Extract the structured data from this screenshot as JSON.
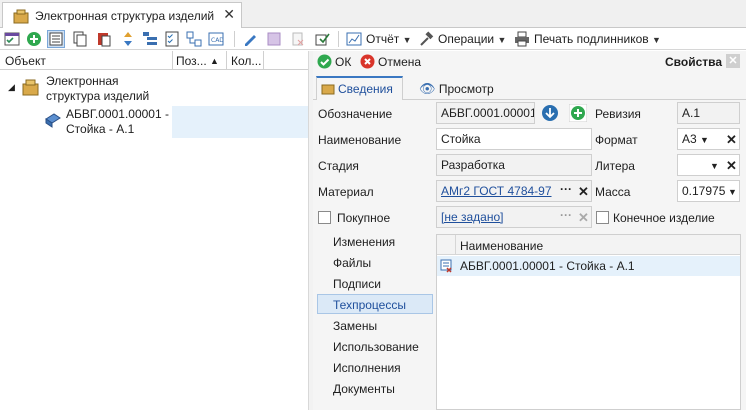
{
  "tab": {
    "title": "Электронная структура изделий",
    "close": "✕"
  },
  "toolbar": {
    "report_label": "Отчёт",
    "operations_label": "Операции",
    "print_label": "Печать подлинников"
  },
  "tree": {
    "columns": [
      "Объект",
      "Поз...",
      "Кол..."
    ],
    "root_label_line1": "Электронная",
    "root_label_line2": "структура изделий",
    "child_label_line1": "АБВГ.0001.00001 -",
    "child_label_line2": "Стойка - А.1"
  },
  "props": {
    "ok_label": "ОК",
    "cancel_label": "Отмена",
    "title": "Свойства",
    "tabs": [
      "Сведения",
      "Просмотр"
    ],
    "fields": {
      "designation_label": "Обозначение",
      "designation_value": "АБВГ.0001.00001",
      "revision_label": "Ревизия",
      "revision_value": "А.1",
      "name_label": "Наименование",
      "name_value": "Стойка",
      "format_label": "Формат",
      "format_value": "А3",
      "stage_label": "Стадия",
      "stage_value": "Разработка",
      "litera_label": "Литера",
      "litera_value": "",
      "material_label": "Материал",
      "material_value": "АМг2 ГОСТ 4784-97",
      "mass_label": "Масса",
      "mass_value": "0.17975",
      "purchased_label": "Покупное",
      "purchased_value": "[не задано]",
      "final_label": "Конечное изделие"
    },
    "nav": [
      "Изменения",
      "Файлы",
      "Подписи",
      "Техпроцессы",
      "Замены",
      "Использование",
      "Исполнения",
      "Документы"
    ],
    "nav_selected": "Техпроцессы",
    "grid": {
      "header": "Наименование",
      "rows": [
        "АБВГ.0001.00001 - Стойка - А.1"
      ]
    }
  }
}
